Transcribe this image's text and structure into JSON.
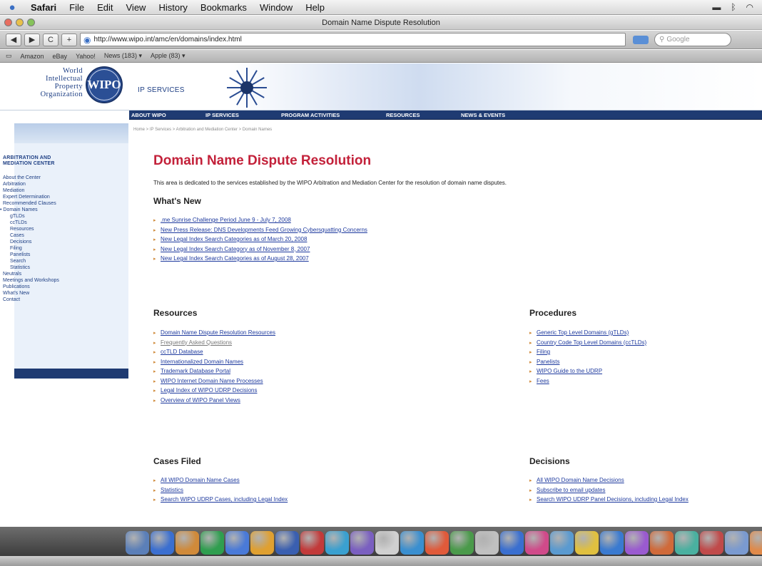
{
  "menubar": {
    "app": "Safari",
    "items": [
      "File",
      "Edit",
      "View",
      "History",
      "Bookmarks",
      "Window",
      "Help"
    ]
  },
  "window": {
    "title": "Domain Name Dispute Resolution"
  },
  "toolbar": {
    "back": "◀",
    "forward": "▶",
    "reload": "C",
    "add": "+",
    "url": "http://www.wipo.int/amc/en/domains/index.html",
    "search_placeholder": "Google"
  },
  "bookmarks": [
    "Amazon",
    "eBay",
    "Yahoo!",
    "News (183) ▾",
    "Apple (83) ▾"
  ],
  "header": {
    "org_lines": [
      "World",
      "Intellectual",
      "Property",
      "Organization"
    ],
    "seal_text": "WIPO",
    "section": "IP SERVICES"
  },
  "nav": [
    "ABOUT WIPO",
    "IP SERVICES",
    "PROGRAM ACTIVITIES",
    "RESOURCES",
    "NEWS & EVENTS"
  ],
  "breadcrumb": "Home > IP Services > Arbitration and Mediation Center > Domain Names",
  "sidebar": {
    "title_1": "ARBITRATION AND",
    "title_2": "MEDIATION CENTER",
    "items": [
      {
        "label": "About the Center",
        "level": 0
      },
      {
        "label": "Arbitration",
        "level": 0
      },
      {
        "label": "Mediation",
        "level": 0
      },
      {
        "label": "Expert Determination",
        "level": 0
      },
      {
        "label": "Recommended Clauses",
        "level": 0
      },
      {
        "label": "• Domain Names",
        "level": -1
      },
      {
        "label": "gTLDs",
        "level": 1
      },
      {
        "label": "ccTLDs",
        "level": 1
      },
      {
        "label": "Resources",
        "level": 1
      },
      {
        "label": "Cases",
        "level": 1
      },
      {
        "label": "Decisions",
        "level": 1
      },
      {
        "label": "Filing",
        "level": 1
      },
      {
        "label": "Panelists",
        "level": 1
      },
      {
        "label": "Search",
        "level": 1
      },
      {
        "label": "Statistics",
        "level": 1
      },
      {
        "label": "Neutrals",
        "level": 0
      },
      {
        "label": "Meetings and Workshops",
        "level": 0
      },
      {
        "label": "Publications",
        "level": 0
      },
      {
        "label": "What's New",
        "level": 0
      },
      {
        "label": "Contact",
        "level": 0
      }
    ]
  },
  "main": {
    "title": "Domain Name Dispute Resolution",
    "intro": "This area is dedicated to the services established by the WIPO Arbitration and Mediation Center for the resolution of domain name disputes.",
    "whats_new": {
      "heading": "What's New",
      "links": [
        ".me Sunrise Challenge Period June 9 - July 7, 2008",
        "New Press Release: DNS Developments Feed Growing Cybersquatting Concerns",
        "New Legal Index Search Categories as of March 20, 2008",
        "New Legal Index Search Category as of November 8, 2007",
        "New Legal Index Search Categories as of August 28, 2007"
      ]
    },
    "resources": {
      "heading": "Resources",
      "links": [
        "Domain Name Dispute Resolution Resources",
        "Frequently Asked Questions",
        "ccTLD Database",
        "Internationalized Domain Names",
        "Trademark Database Portal",
        "WIPO Internet Domain Name Processes",
        "Legal Index of WIPO UDRP Decisions",
        "Overview of WIPO Panel Views"
      ]
    },
    "procedures": {
      "heading": "Procedures",
      "links": [
        "Generic Top Level Domains (gTLDs)",
        "Country Code Top Level Domains (ccTLDs)",
        "Filing",
        "Panelists",
        "WIPO Guide to the UDRP",
        "Fees"
      ]
    },
    "cases_filed": {
      "heading": "Cases Filed",
      "links": [
        "All WIPO Domain Name Cases",
        "Statistics",
        "Search WIPO UDRP Cases, including Legal Index"
      ]
    },
    "decisions": {
      "heading": "Decisions",
      "links": [
        "All WIPO Domain Name Decisions",
        "Subscribe to email updates",
        "Search WIPO UDRP Panel Decisions, including Legal Index"
      ]
    }
  },
  "dock_colors": [
    "#5b7fb8",
    "#3b6fd0",
    "#d08a3a",
    "#2f9e4f",
    "#4a7ad8",
    "#e0a030",
    "#3a5fb0",
    "#c23a3a",
    "#3aa0d0",
    "#7a5fc0",
    "#d0d0d0",
    "#3a8fd0",
    "#e05a3a",
    "#4a9a4a",
    "#c0c0c0",
    "#3a6fd0",
    "#d04a8a",
    "#5a9ad0",
    "#e0c040",
    "#3a7ad0",
    "#9a5ad0",
    "#d06a3a",
    "#4ab0a0",
    "#c04a4a",
    "#7a9ad0",
    "#e08a4a"
  ]
}
